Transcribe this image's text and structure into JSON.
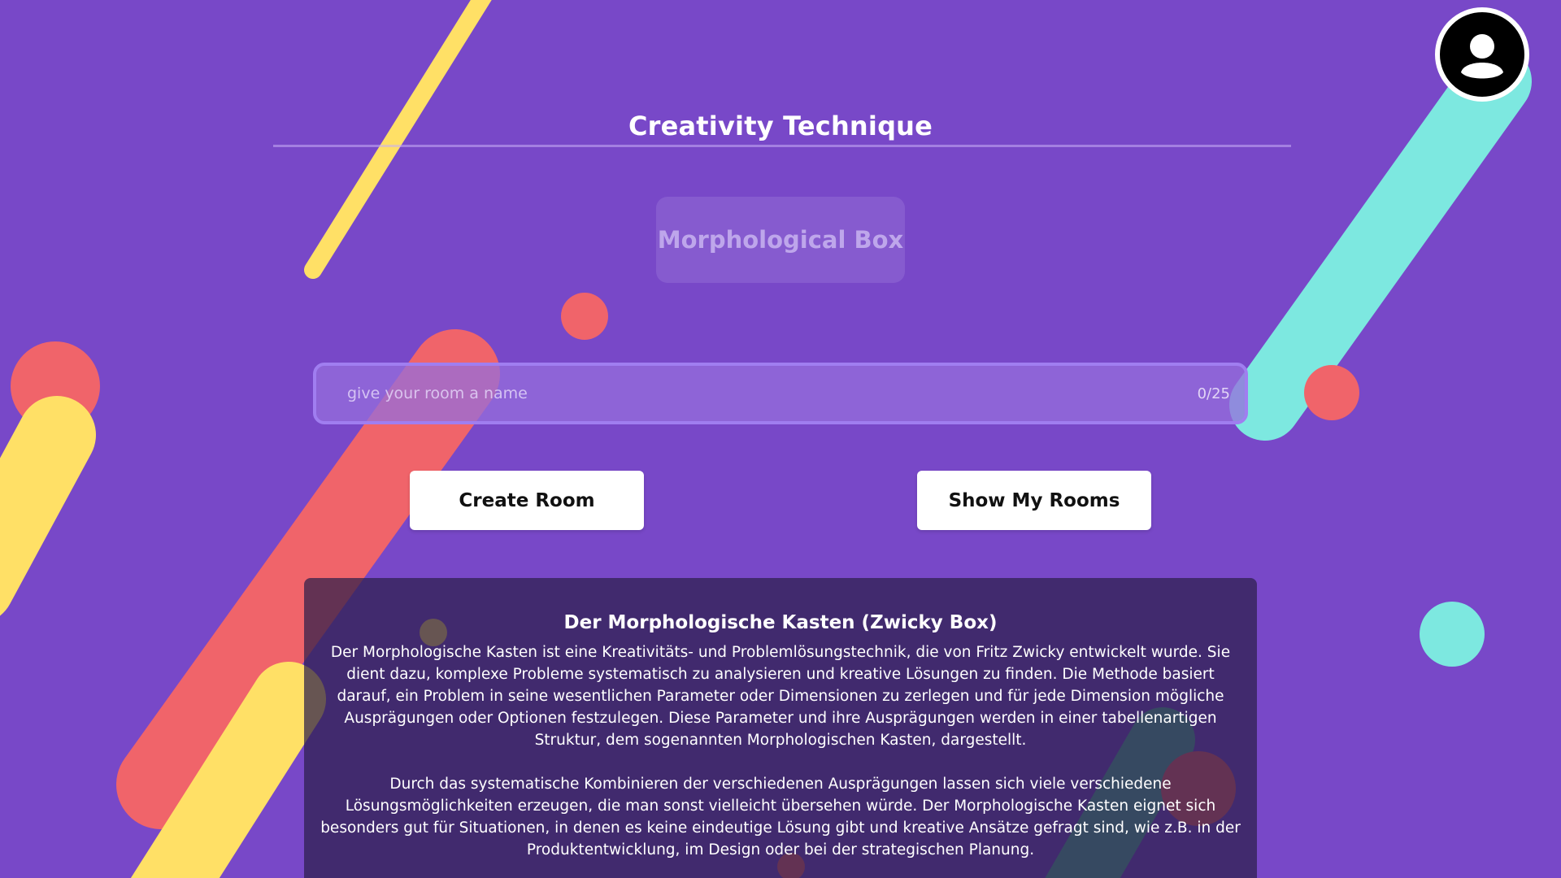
{
  "header": {
    "title": "Creativity Technique"
  },
  "technique": {
    "selected_label": "Morphological Box"
  },
  "room_form": {
    "name_placeholder": "give your room a name",
    "char_counter": "0/25"
  },
  "actions": {
    "create_room_label": "Create Room",
    "show_rooms_label": "Show My Rooms"
  },
  "info": {
    "heading": "Der Morphologische Kasten (Zwicky Box)",
    "paragraph_1": "Der Morphologische Kasten ist eine Kreativitäts- und Problemlösungstechnik, die von Fritz Zwicky entwickelt wurde. Sie dient dazu, komplexe Probleme systematisch zu analysieren und kreative Lösungen zu finden. Die Methode basiert darauf, ein Problem in seine wesentlichen Parameter oder Dimensionen zu zerlegen und für jede Dimension mögliche Ausprägungen oder Optionen festzulegen. Diese Parameter und ihre Ausprägungen werden in einer tabellenartigen Struktur, dem sogenannten Morphologischen Kasten, dargestellt.",
    "paragraph_2": "Durch das systematische Kombinieren der verschiedenen Ausprägungen lassen sich viele verschiedene Lösungsmöglichkeiten erzeugen, die man sonst vielleicht übersehen würde. Der Morphologische Kasten eignet sich besonders gut für Situationen, in denen es keine eindeutige Lösung gibt und kreative Ansätze gefragt sind, wie z.B. in der Produktentwicklung, im Design oder bei der strategischen Planung."
  },
  "icons": {
    "avatar": "user-avatar-icon"
  },
  "colors": {
    "background": "#7848c8",
    "accent_yellow": "#ffe066",
    "accent_coral": "#f0646a",
    "accent_teal": "#7de8e0",
    "button_bg": "#ffffff",
    "panel_bg": "#2d1e4b"
  }
}
